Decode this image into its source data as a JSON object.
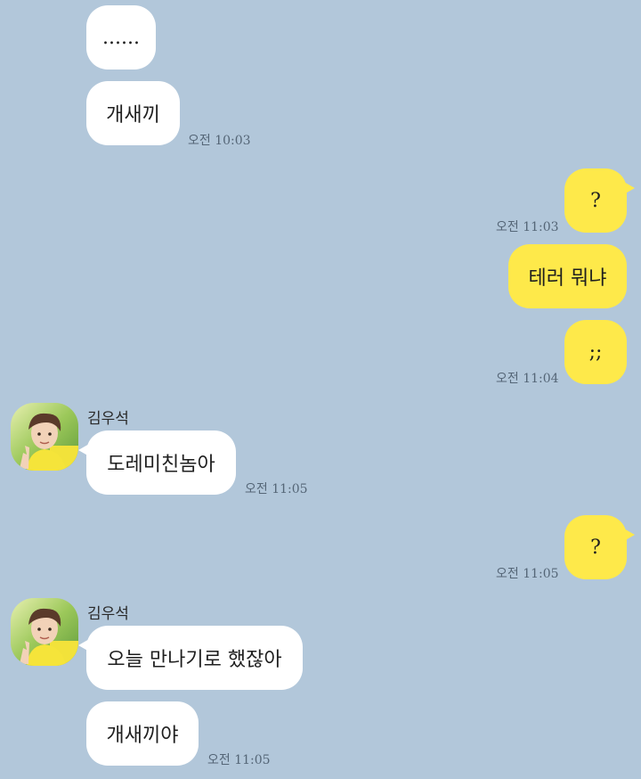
{
  "colors": {
    "background": "#b2c7da",
    "incoming_bubble": "#ffffff",
    "outgoing_bubble": "#fee94a",
    "time_text": "#556677"
  },
  "messages": [
    {
      "side": "in",
      "text": "......"
    },
    {
      "side": "in",
      "text": "개새끼",
      "time": "오전 10:03"
    },
    {
      "side": "out",
      "text": "?",
      "time": "오전 11:03"
    },
    {
      "side": "out",
      "text": "테러 뭐냐"
    },
    {
      "side": "out",
      "text": ";;",
      "time": "오전 11:04"
    },
    {
      "side": "in",
      "sender": "김우석",
      "avatar_icon": "profile-photo",
      "text": "도레미친놈아",
      "time": "오전 11:05"
    },
    {
      "side": "out",
      "text": "?",
      "time": "오전 11:05"
    },
    {
      "side": "in",
      "sender": "김우석",
      "avatar_icon": "profile-photo",
      "text": "오늘 만나기로 했잖아"
    },
    {
      "side": "in",
      "text": "개새끼야",
      "time": "오전 11:05"
    }
  ]
}
